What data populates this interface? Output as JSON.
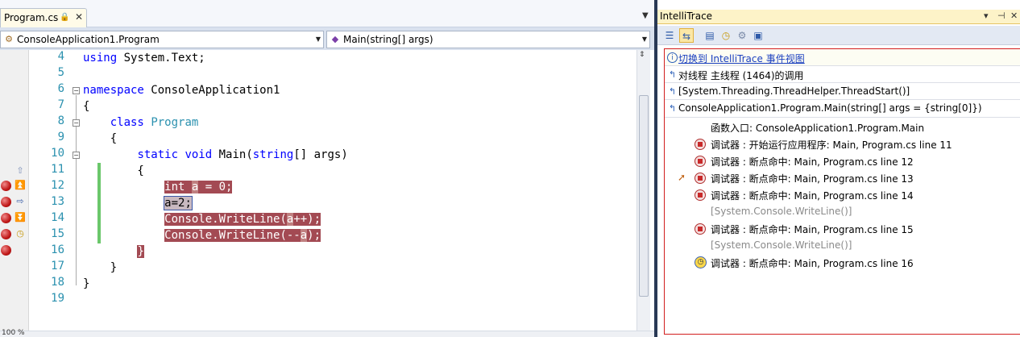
{
  "editor": {
    "tab": {
      "title": "Program.cs",
      "lock_icon": "lock-icon",
      "close_icon": "close-icon"
    },
    "class_combo": "ConsoleApplication1.Program",
    "member_combo": "Main(string[] args)",
    "zoom": "100 %",
    "lines": [
      {
        "num": "4",
        "text": "using System.Text;"
      },
      {
        "num": "5",
        "text": ""
      },
      {
        "num": "6",
        "text": "namespace ConsoleApplication1"
      },
      {
        "num": "7",
        "text": "{"
      },
      {
        "num": "8",
        "text": "    class Program"
      },
      {
        "num": "9",
        "text": "    {"
      },
      {
        "num": "10",
        "text": "        static void Main(string[] args)"
      },
      {
        "num": "11",
        "text": "        {"
      },
      {
        "num": "12",
        "text": "            int a = 0;"
      },
      {
        "num": "13",
        "text": "            a=2;"
      },
      {
        "num": "14",
        "text": "            Console.WriteLine(a++);"
      },
      {
        "num": "15",
        "text": "            Console.WriteLine(--a);"
      },
      {
        "num": "16",
        "text": "        }"
      },
      {
        "num": "17",
        "text": "    }"
      },
      {
        "num": "18",
        "text": "}"
      },
      {
        "num": "19",
        "text": ""
      }
    ]
  },
  "intellitrace": {
    "title": "IntelliTrace",
    "title_buttons": [
      "▾",
      "⊣",
      "✕"
    ],
    "switch_link": "切换到 IntelliTrace 事件视图",
    "call_rows": [
      "对线程 主线程 (1464)的调用",
      "[System.Threading.ThreadHelper.ThreadStart()]",
      "ConsoleApplication1.Program.Main(string[] args = {string[0]})"
    ],
    "events": [
      {
        "text": "函数入口: ConsoleApplication1.Program.Main",
        "icon": "none"
      },
      {
        "text": "调试器 : 开始运行应用程序: Main, Program.cs line 11",
        "icon": "stop-icon"
      },
      {
        "text": "调试器 : 断点命中: Main, Program.cs line 12",
        "icon": "stop-icon"
      },
      {
        "text": "调试器 : 断点命中: Main, Program.cs line 13",
        "icon": "stop-icon"
      },
      {
        "text": "调试器 : 断点命中: Main, Program.cs line 14",
        "icon": "stop-icon"
      },
      {
        "text": "[System.Console.WriteLine()]",
        "icon": "none"
      },
      {
        "text": "调试器 : 断点命中: Main, Program.cs line 15",
        "icon": "stop-icon"
      },
      {
        "text": "[System.Console.WriteLine()]",
        "icon": "none"
      },
      {
        "text": "调试器 : 断点命中: Main, Program.cs line 16",
        "icon": "clock-icon"
      }
    ]
  }
}
